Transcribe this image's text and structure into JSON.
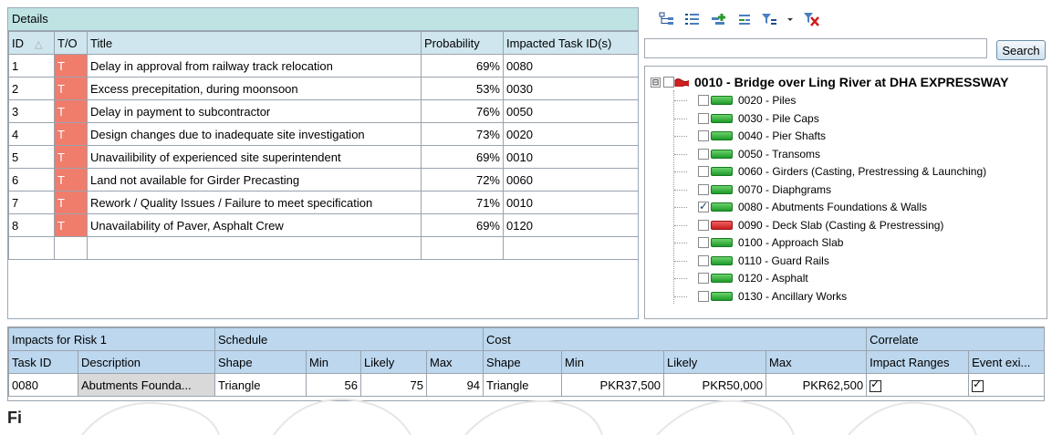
{
  "details": {
    "title": "Details",
    "columns": [
      "ID",
      "T/O",
      "Title",
      "Probability",
      "Impacted Task ID(s)"
    ],
    "rows": [
      {
        "id": "1",
        "to": "T",
        "title": "Delay in approval from railway track relocation",
        "probability": "69%",
        "task": "0080"
      },
      {
        "id": "2",
        "to": "T",
        "title": "Excess precepitation, during moonsoon",
        "probability": "53%",
        "task": "0030"
      },
      {
        "id": "3",
        "to": "T",
        "title": "Delay in payment to subcontractor",
        "probability": "76%",
        "task": "0050"
      },
      {
        "id": "4",
        "to": "T",
        "title": "Design changes due to inadequate site investigation",
        "probability": "73%",
        "task": "0020"
      },
      {
        "id": "5",
        "to": "T",
        "title": "Unavailibility of experienced site superintendent",
        "probability": "69%",
        "task": "0010"
      },
      {
        "id": "6",
        "to": "T",
        "title": "Land not available for Girder Precasting",
        "probability": "72%",
        "task": "0060"
      },
      {
        "id": "7",
        "to": "T",
        "title": "Rework / Quality Issues / Failure to meet specification",
        "probability": "71%",
        "task": "0010"
      },
      {
        "id": "8",
        "to": "T",
        "title": "Unavailability of Paver, Asphalt Crew",
        "probability": "69%",
        "task": "0120"
      }
    ],
    "to_color": "#f07c6c"
  },
  "search": {
    "value": "",
    "button_label": "Search"
  },
  "tree": {
    "root": {
      "label": "0010 - Bridge over Ling River at DHA EXPRESSWAY",
      "expander": "⊟",
      "status": "red"
    },
    "children": [
      {
        "label": "0020 - Piles",
        "status": "green",
        "checked": false
      },
      {
        "label": "0030 - Pile Caps",
        "status": "green",
        "checked": false
      },
      {
        "label": "0040 - Pier Shafts",
        "status": "green",
        "checked": false
      },
      {
        "label": "0050 - Transoms",
        "status": "green",
        "checked": false
      },
      {
        "label": "0060 - Girders (Casting, Prestressing & Launching)",
        "status": "green",
        "checked": false
      },
      {
        "label": "0070 - Diaphgrams",
        "status": "green",
        "checked": false
      },
      {
        "label": "0080 - Abutments Foundations & Walls",
        "status": "green",
        "checked": true
      },
      {
        "label": "0090 - Deck Slab (Casting & Prestressing)",
        "status": "red",
        "checked": false
      },
      {
        "label": "0100 - Approach Slab",
        "status": "green",
        "checked": false
      },
      {
        "label": "0110 - Guard Rails",
        "status": "green",
        "checked": false
      },
      {
        "label": "0120 - Asphalt",
        "status": "green",
        "checked": false
      },
      {
        "label": "0130 - Ancillary Works",
        "status": "green",
        "checked": false
      }
    ]
  },
  "toolbar_icons": [
    "tree-view-icon",
    "list-view-icon",
    "add-task-icon",
    "collapse-icon",
    "filter-icon",
    "filter-dropdown-icon",
    "clear-filter-icon"
  ],
  "impacts": {
    "groups": {
      "impacts_for": "Impacts for Risk 1",
      "schedule": "Schedule",
      "cost": "Cost",
      "correlate": "Correlate"
    },
    "columns": [
      "Task ID",
      "Description",
      "Shape",
      "Min",
      "Likely",
      "Max",
      "Shape",
      "Min",
      "Likely",
      "Max",
      "Impact Ranges",
      "Event exi..."
    ],
    "rows": [
      {
        "task_id": "0080",
        "description": "Abutments Founda...",
        "sched_shape": "Triangle",
        "sched_min": "56",
        "sched_likely": "75",
        "sched_max": "94",
        "cost_shape": "Triangle",
        "cost_min": "PKR37,500",
        "cost_likely": "PKR50,000",
        "cost_max": "PKR62,500",
        "impact_ranges": true,
        "event_exists": true
      }
    ]
  },
  "figure_label": "Fi"
}
